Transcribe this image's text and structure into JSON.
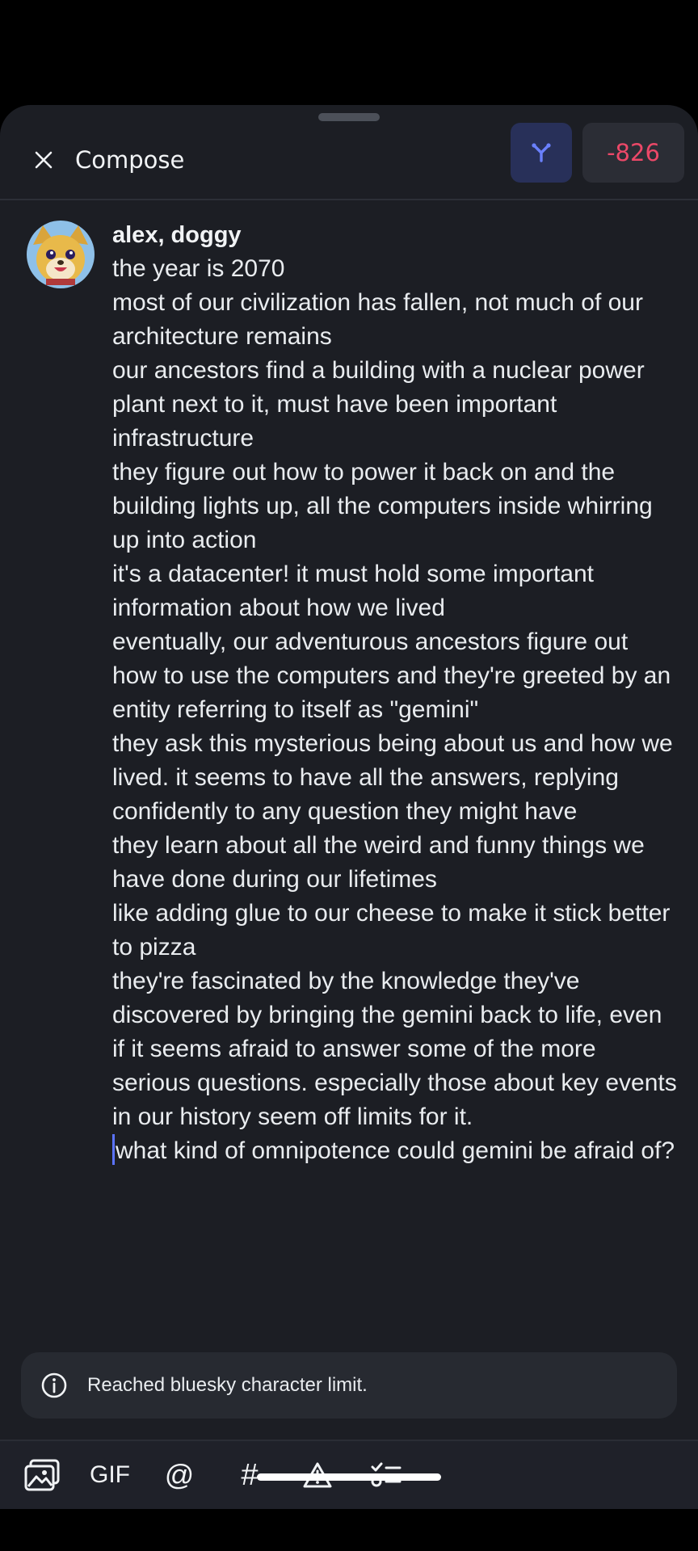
{
  "header": {
    "title": "Compose",
    "char_count": "-826"
  },
  "post": {
    "author": "alex, doggy",
    "text_before_caret": "the year is 2070\nmost of our civilization has fallen, not much of our architecture remains\nour ancestors find a building with a nuclear power plant next to it, must have been important infrastructure\nthey figure out how to power it back on and the building lights up, all the computers inside whirring up into action\nit's a datacenter! it must hold some important information about how we lived\neventually, our adventurous ancestors figure out how to use the computers and they're greeted by an entity referring to itself as \"gemini\"\nthey ask this mysterious being about us and how we lived. it seems to have all the answers, replying confidently to any question they might have\nthey learn about all the weird and funny things we have done during our lifetimes\nlike adding glue to our cheese to make it stick better to pizza\nthey're fascinated by the knowledge they've discovered by bringing the gemini back to life, even if it seems afraid to answer some of the more serious questions. especially those about key events in our history seem off limits for it.\n",
    "text_after_caret": "what kind of omnipotence could gemini be afraid of?"
  },
  "notice": {
    "text": "Reached bluesky character limit."
  },
  "toolbar": {
    "gif_label": "GIF",
    "mention_label": "@",
    "hashtag_label": "#"
  },
  "colors": {
    "background": "#1c1e24",
    "accent": "#5b73ff",
    "over_limit": "#ec4868"
  },
  "icons": [
    "close-icon",
    "thread-icon",
    "info-icon",
    "image-icon",
    "warning-icon",
    "checklist-icon"
  ]
}
